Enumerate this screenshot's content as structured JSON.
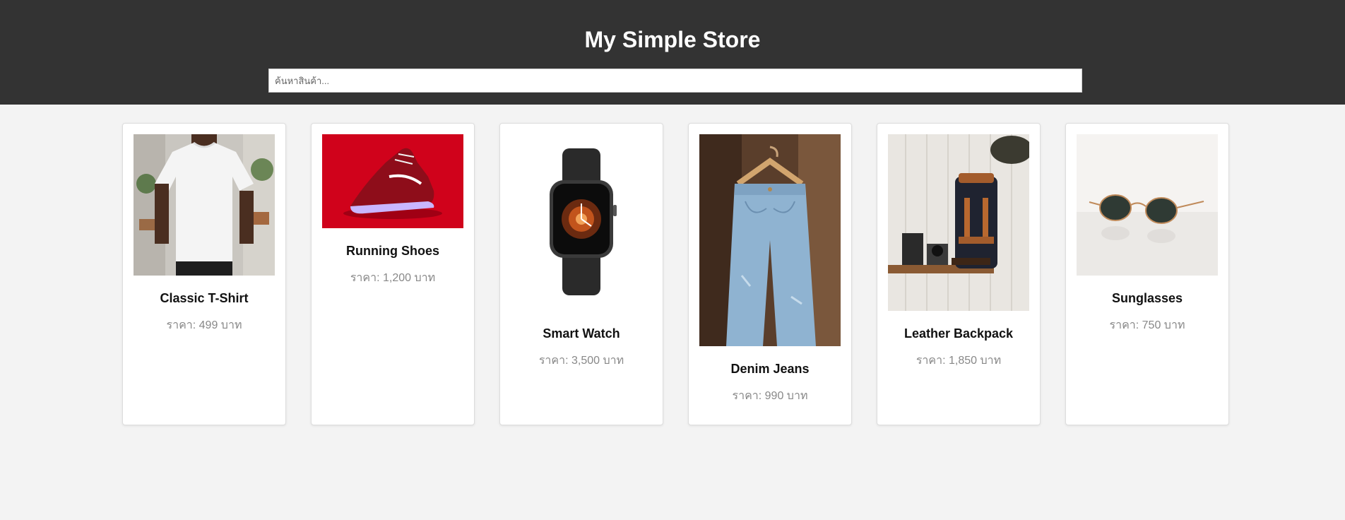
{
  "header": {
    "title": "My Simple Store",
    "search_placeholder": "ค้นหาสินค้า..."
  },
  "products": [
    {
      "name": "Classic T-Shirt",
      "price_label": "ราคา: ",
      "price": "499",
      "currency": " บาท",
      "image_icon": "tshirt-photo"
    },
    {
      "name": "Running Shoes",
      "price_label": "ราคา: ",
      "price": "1,200",
      "currency": " บาท",
      "image_icon": "shoe-photo"
    },
    {
      "name": "Smart Watch",
      "price_label": "ราคา: ",
      "price": "3,500",
      "currency": " บาท",
      "image_icon": "watch-photo"
    },
    {
      "name": "Denim Jeans",
      "price_label": "ราคา: ",
      "price": "990",
      "currency": " บาท",
      "image_icon": "jeans-photo"
    },
    {
      "name": "Leather Backpack",
      "price_label": "ราคา: ",
      "price": "1,850",
      "currency": " บาท",
      "image_icon": "backpack-photo"
    },
    {
      "name": "Sunglasses",
      "price_label": "ราคา: ",
      "price": "750",
      "currency": " บาท",
      "image_icon": "sunglasses-photo"
    }
  ],
  "colors": {
    "header_bg": "#333333",
    "page_bg": "#f3f3f3",
    "card_bg": "#ffffff",
    "price_text": "#888888"
  }
}
